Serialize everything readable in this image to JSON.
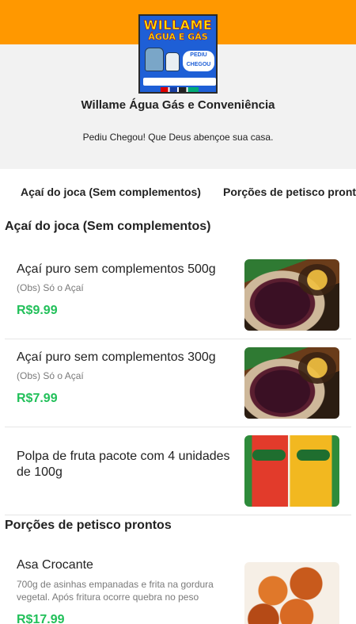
{
  "store": {
    "logo": {
      "line1": "WILLAME",
      "line2": "ÁGUA E GÁS",
      "badge": "PEDIU CHEGOU"
    },
    "name": "Willame Água Gás e Conveniência",
    "tagline": "Pediu Chegou! Que Deus abençoe sua casa."
  },
  "tabs": [
    {
      "label": "Açaí do joca (Sem complementos)"
    },
    {
      "label": "Porções de petisco prontos"
    }
  ],
  "sections": [
    {
      "title": "Açaí do joca (Sem complementos)",
      "products": [
        {
          "name": "Açaí puro sem complementos 500g",
          "description": "(Obs) Só o Açaí",
          "price": "R$9.99",
          "image": "acai-cup-photo"
        },
        {
          "name": "Açaí puro sem complementos 300g",
          "description": "(Obs) Só o Açaí",
          "price": "R$7.99",
          "image": "acai-cup-photo"
        },
        {
          "name": "Polpa de fruta pacote com 4 unidades de 100g",
          "description": "",
          "price": "",
          "image": "fruit-pulp-packs-photo"
        }
      ]
    },
    {
      "title": "Porções de petisco prontos",
      "products": [
        {
          "name": "Asa Crocante",
          "description": "700g de asinhas empanadas e frita na gordura vegetal. Após fritura ocorre quebra no peso",
          "price": "R$17.99",
          "image": "fried-chicken-wings-photo"
        }
      ]
    }
  ],
  "colors": {
    "accent": "#ff9800",
    "price": "#22c05a",
    "header_bg": "#f2f2f2"
  }
}
